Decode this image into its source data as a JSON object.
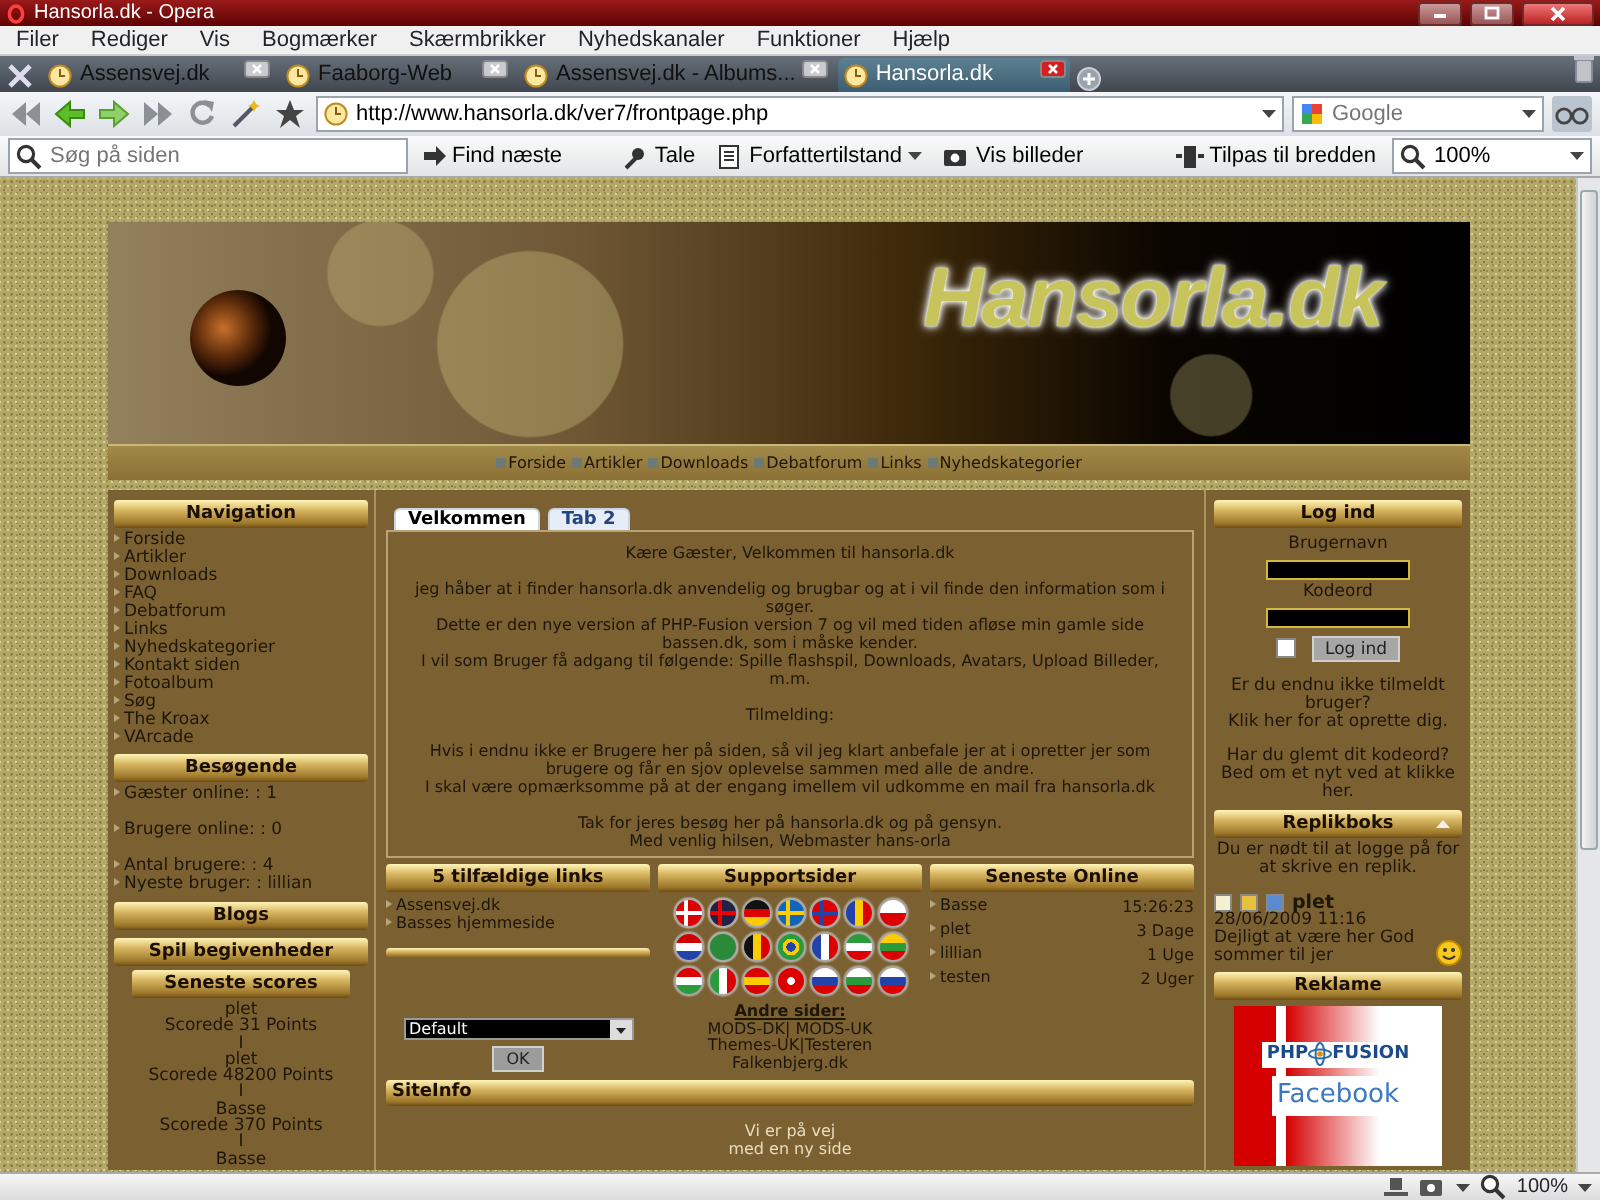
{
  "window": {
    "title": "Hansorla.dk - Opera"
  },
  "menu": [
    "Filer",
    "Rediger",
    "Vis",
    "Bogmærker",
    "Skærmbrikker",
    "Nyhedskanaler",
    "Funktioner",
    "Hjælp"
  ],
  "tabs": [
    {
      "label": "Assensvej.dk",
      "selected": false
    },
    {
      "label": "Faaborg-Web",
      "selected": false
    },
    {
      "label": "Assensvej.dk - Albums...",
      "selected": false
    },
    {
      "label": "Hansorla.dk",
      "selected": true
    }
  ],
  "address_bar": {
    "url": "http://www.hansorla.dk/ver7/frontpage.php"
  },
  "search_field": {
    "placeholder": "Google"
  },
  "find_bar": {
    "placeholder": "Søg på siden",
    "find_next": "Find næste",
    "tools": [
      {
        "label": "Tale",
        "has_menu": false
      },
      {
        "label": "Forfattertilstand",
        "has_menu": true
      },
      {
        "label": "Vis billeder",
        "has_menu": false
      },
      {
        "label": "Tilpas til bredden",
        "has_menu": false
      }
    ],
    "zoom": "100%"
  },
  "site": {
    "logo": "Hansorla.dk",
    "nav_links": [
      "Forside",
      "Artikler",
      "Downloads",
      "Debatforum",
      "Links",
      "Nyhedskategorier"
    ]
  },
  "navigation": {
    "title": "Navigation",
    "items": [
      "Forside",
      "Artikler",
      "Downloads",
      "FAQ",
      "Debatforum",
      "Links",
      "Nyhedskategorier",
      "Kontakt siden",
      "Fotoalbum",
      "Søg",
      "The Kroax",
      "VArcade"
    ]
  },
  "visitors": {
    "title": "Besøgende",
    "groups": [
      [
        "Gæster online: : 1"
      ],
      [
        "Brugere online: : 0"
      ],
      [
        "Antal brugere: : 4",
        "Nyeste bruger: : lillian"
      ]
    ]
  },
  "blogs": {
    "title": "Blogs"
  },
  "games": {
    "title": "Spil begivenheder",
    "scores_title": "Seneste scores",
    "scores": [
      "plet",
      "Scorede 31 Points",
      "I",
      "plet",
      "Scorede 48200 Points",
      "I",
      "Basse",
      "Scorede 370 Points",
      "I",
      "Basse"
    ]
  },
  "center_tabs": [
    {
      "label": "Velkommen",
      "selected": true
    },
    {
      "label": "Tab 2",
      "selected": false
    }
  ],
  "welcome": [
    [
      "Kære Gæster, Velkommen til hansorla.dk"
    ],
    [
      "jeg håber at i finder hansorla.dk anvendelig og brugbar og at i vil finde den information som i søger.",
      "Dette er den nye version af PHP-Fusion version 7 og vil med tiden afløse min gamle side bassen.dk, som i måske kender.",
      "I vil som Bruger få adgang til følgende: Spille flashspil, Downloads, Avatars, Upload Billeder, m.m."
    ],
    [
      "Tilmelding:"
    ],
    [
      "Hvis i endnu ikke er Brugere her på siden, så vil jeg klart anbefale jer at i opretter jer som brugere og får en sjov oplevelse sammen med alle de andre.",
      "I skal være opmærksomme på at der engang imellem vil udkomme en mail fra hansorla.dk"
    ],
    [
      "Tak for jeres besøg her på hansorla.dk og på gensyn.",
      "Med venlig hilsen, Webmaster hans-orla"
    ]
  ],
  "random_links": {
    "title": "5 tilfældige links",
    "items": [
      "Assensvej.dk",
      "Basses hjemmeside"
    ]
  },
  "theme_select": {
    "value": "Default",
    "button": "OK"
  },
  "support": {
    "title": "Supportsider",
    "other_title": "Andre sider:",
    "other_lines": [
      "MODS-DK| MODS-UK",
      "Themes-UK|Testeren",
      "Falkenbjerg.dk"
    ]
  },
  "latest_online": {
    "title": "Seneste Online",
    "rows": [
      {
        "name": "Basse",
        "time": "15:26:23"
      },
      {
        "name": "plet",
        "time": "3 Dage"
      },
      {
        "name": "lillian",
        "time": "1 Uge"
      },
      {
        "name": "testen",
        "time": "2 Uger"
      }
    ]
  },
  "site_info": {
    "title": "SiteInfo",
    "lines": [
      "Vi er på vej",
      "med en ny side"
    ]
  },
  "login": {
    "title": "Log ind",
    "username_label": "Brugernavn",
    "password_label": "Kodeord",
    "remember": false,
    "button": "Log ind",
    "register_text": "Er du endnu ikke tilmeldt bruger?",
    "register_link": "Klik her for at oprette dig.",
    "forgot_text": "Har du glemt dit kodeord?",
    "forgot_link": "Bed om et nyt ved at klikke her."
  },
  "shoutbox": {
    "title": "Replikboks",
    "notice": "Du er nødt til at logge på for at skrive en replik.",
    "posts": [
      {
        "user": "plet",
        "date": "28/06/2009 11:16",
        "message": "Dejligt at være her God sommer til jer"
      }
    ]
  },
  "ads": {
    "title": "Reklame",
    "brand_left": "PHP",
    "brand_right": "FUSION",
    "caption": "Facebook"
  },
  "status_bar": {
    "zoom": "100%"
  }
}
